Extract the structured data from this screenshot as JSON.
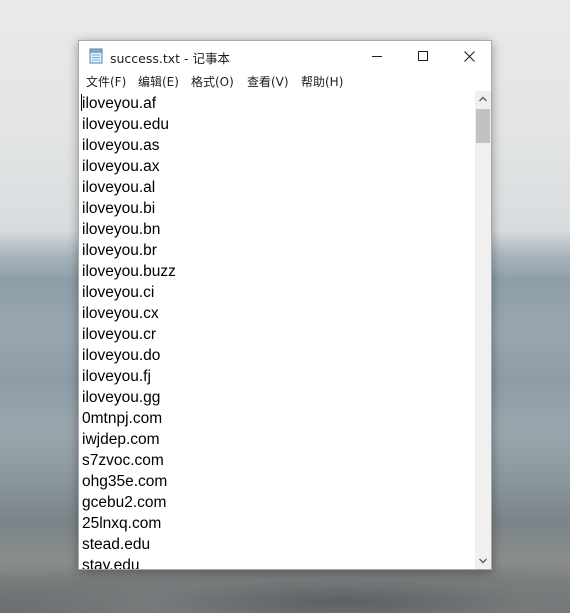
{
  "window": {
    "title": "success.txt - 记事本"
  },
  "menu": [
    "文件(F)",
    "编辑(E)",
    "格式(O)",
    "查看(V)",
    "帮助(H)"
  ],
  "editor": {
    "lines": [
      "iloveyou.af",
      "iloveyou.edu",
      "iloveyou.as",
      "iloveyou.ax",
      "iloveyou.al",
      "iloveyou.bi",
      "iloveyou.bn",
      "iloveyou.br",
      "iloveyou.buzz",
      "iloveyou.ci",
      "iloveyou.cx",
      "iloveyou.cr",
      "iloveyou.do",
      "iloveyou.fj",
      "iloveyou.gg",
      "0mtnpj.com",
      "iwjdep.com",
      "s7zvoc.com",
      "ohg35e.com",
      "gcebu2.com",
      "25lnxq.com",
      "stead.edu",
      "stay.edu"
    ]
  },
  "icons": {
    "app": "notepad-icon",
    "minimize": "minimize-icon",
    "maximize": "maximize-icon",
    "close": "close-icon",
    "scroll_up": "chevron-up-icon",
    "scroll_down": "chevron-down-icon"
  }
}
